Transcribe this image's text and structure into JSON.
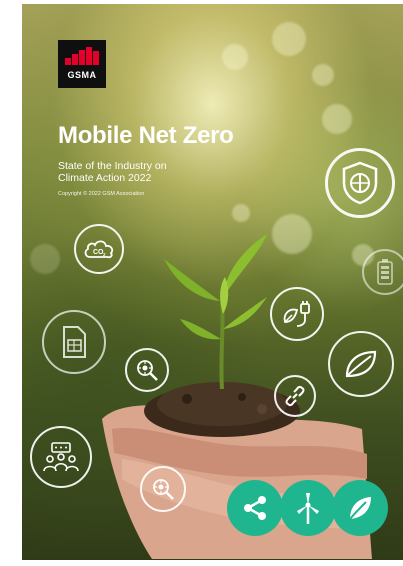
{
  "logo": {
    "text": "GSMA"
  },
  "title": "Mobile Net Zero",
  "subtitle_line1": "State of the Industry on",
  "subtitle_line2": "Climate Action 2022",
  "copyright": "Copyright © 2022 GSM Association",
  "co2_label": "CO",
  "co2_sub": "2",
  "colors": {
    "accent_green": "#1fb58f",
    "logo_red": "#e4002b",
    "logo_bg": "#0f0f0f"
  },
  "icons": [
    "shield-energy-icon",
    "co2-cloud-icon",
    "battery-icon",
    "plug-leaf-icon",
    "sim-card-icon",
    "magnifier-sun-icon",
    "leaf-icon",
    "link-icon",
    "people-meeting-icon",
    "share-icon",
    "wind-turbine-icon"
  ]
}
